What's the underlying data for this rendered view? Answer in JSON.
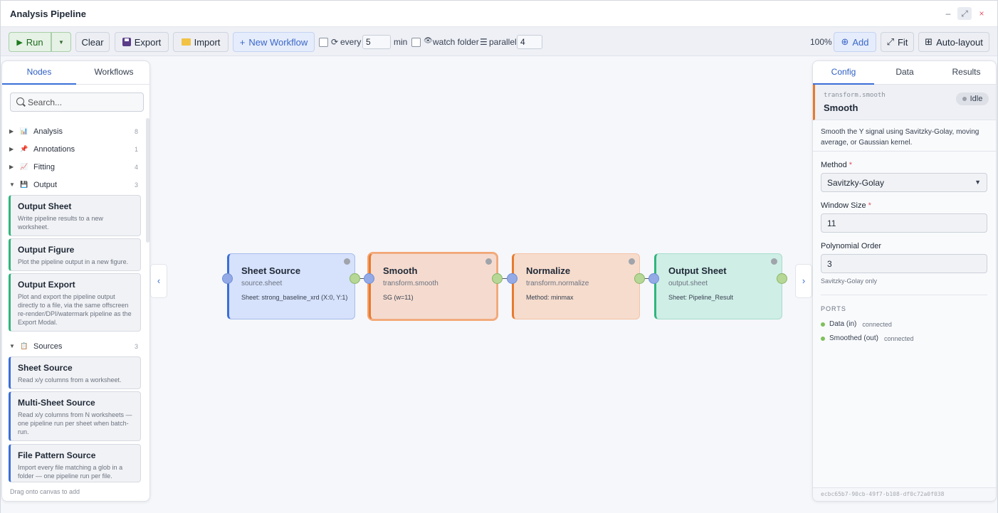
{
  "window": {
    "title": "Analysis Pipeline",
    "controls": {
      "min": "–",
      "max": "⤢",
      "close": "×"
    }
  },
  "toolbar": {
    "run": "Run",
    "run_icon": "▶",
    "run_drop": "▼",
    "clear": "Clear",
    "export": "Export",
    "import": "Import",
    "new_workflow": "New Workflow",
    "new_workflow_icon": "+",
    "every_label": "every",
    "every_value": "5",
    "every_unit": "min",
    "watch_folder": "watch folder",
    "parallel_label": "parallel",
    "parallel_value": "4",
    "zoom": "100%",
    "add": "Add",
    "add_icon": "⊕",
    "fit": "Fit",
    "fit_icon": "⤢",
    "autolayout": "Auto-layout",
    "autolayout_icon": "⊞"
  },
  "left_panel": {
    "tabs": [
      "Nodes",
      "Workflows"
    ],
    "search_placeholder": "Search...",
    "categories": [
      {
        "label": "Analysis",
        "count": "8",
        "arrow": "▶",
        "icon": "📊"
      },
      {
        "label": "Annotations",
        "count": "1",
        "arrow": "▶",
        "icon": "📌"
      },
      {
        "label": "Fitting",
        "count": "4",
        "arrow": "▶",
        "icon": "📈"
      },
      {
        "label": "Output",
        "count": "3",
        "arrow": "▼",
        "icon": "💾"
      },
      {
        "label": "Sources",
        "count": "3",
        "arrow": "▼",
        "icon": "📋"
      }
    ],
    "output_cards": [
      {
        "title": "Output Sheet",
        "desc": "Write pipeline results to a new worksheet."
      },
      {
        "title": "Output Figure",
        "desc": "Plot the pipeline output in a new figure."
      },
      {
        "title": "Output Export",
        "desc": "Plot and export the pipeline output directly to a file, via the same offscreen re-render/DPI/watermark pipeline as the Export Modal."
      }
    ],
    "source_cards": [
      {
        "title": "Sheet Source",
        "desc": "Read x/y columns from a worksheet."
      },
      {
        "title": "Multi-Sheet Source",
        "desc": "Read x/y columns from N worksheets — one pipeline run per sheet when batch-run."
      },
      {
        "title": "File Pattern Source",
        "desc": "Import every file matching a glob in a folder — one pipeline run per file."
      }
    ],
    "footer": "Drag onto canvas to add"
  },
  "nodes": [
    {
      "title": "Sheet Source",
      "type": "source.sheet",
      "param": "Sheet: strong_baseline_xrd (X:0, Y:1)"
    },
    {
      "title": "Smooth",
      "type": "transform.smooth",
      "param": "SG (w=11)"
    },
    {
      "title": "Normalize",
      "type": "transform.normalize",
      "param": "Method: minmax"
    },
    {
      "title": "Output Sheet",
      "type": "output.sheet",
      "param": "Sheet: Pipeline_Result"
    }
  ],
  "right_panel": {
    "tabs": [
      "Config",
      "Data",
      "Results"
    ],
    "node_type": "transform.smooth",
    "node_name": "Smooth",
    "status": "Idle",
    "description": "Smooth the Y signal using Savitzky-Golay, moving average, or Gaussian kernel.",
    "method_label": "Method",
    "method_value": "Savitzky-Golay",
    "required_mark": "*",
    "window_label": "Window Size",
    "window_value": "11",
    "poly_label": "Polynomial Order",
    "poly_value": "3",
    "poly_hint": "Savitzky-Golay only",
    "ports_heading": "PORTS",
    "ports": [
      {
        "name": "Data (in)",
        "state": "connected"
      },
      {
        "name": "Smoothed (out)",
        "state": "connected"
      }
    ],
    "node_id": "ecbc65b7-90cb-49f7-b108-df0c72a0f038"
  },
  "collapse": {
    "left": "‹",
    "right": "›"
  },
  "colors": {
    "accent": "#3b6fd8",
    "source": "#3b6fd8",
    "transform": "#e87a2e",
    "output": "#2fb57c"
  }
}
